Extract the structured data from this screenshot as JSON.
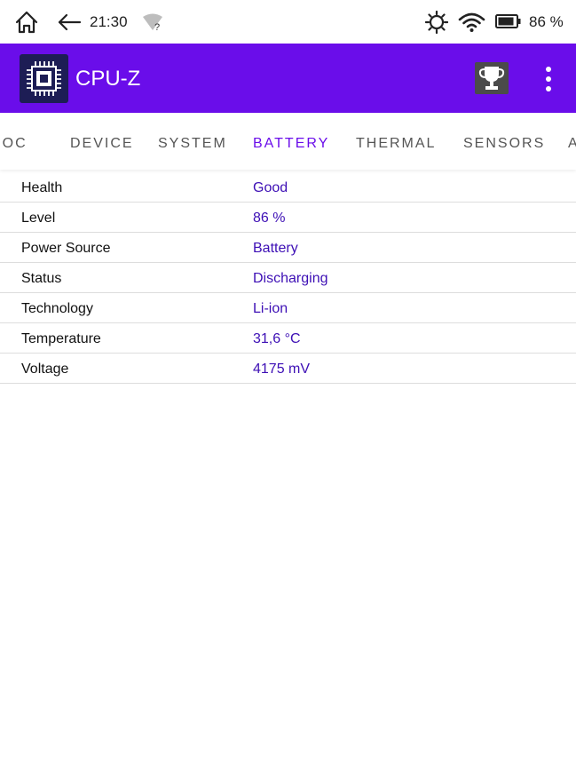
{
  "status_bar": {
    "time": "21:30",
    "battery_percent": "86 %",
    "icons": [
      "home-icon",
      "back-arrow-icon",
      "wifi-unknown-icon",
      "brightness-icon",
      "wifi-icon",
      "battery-icon"
    ]
  },
  "app_bar": {
    "title": "CPU-Z",
    "icons": [
      "cpu-chip-icon",
      "trophy-icon",
      "more-vert-icon"
    ],
    "colors": {
      "primary": "#6a0dea",
      "logo_bg": "#1d1d55"
    }
  },
  "tabs": [
    {
      "label": "SOC"
    },
    {
      "label": "DEVICE"
    },
    {
      "label": "SYSTEM"
    },
    {
      "label": "BATTERY",
      "active": true
    },
    {
      "label": "THERMAL"
    },
    {
      "label": "SENSORS"
    },
    {
      "label": "A"
    }
  ],
  "battery": {
    "rows": [
      {
        "label": "Health",
        "value": "Good"
      },
      {
        "label": "Level",
        "value": "86 %"
      },
      {
        "label": "Power Source",
        "value": "Battery"
      },
      {
        "label": "Status",
        "value": "Discharging"
      },
      {
        "label": "Technology",
        "value": "Li-ion"
      },
      {
        "label": "Temperature",
        "value": "31,6 °C"
      },
      {
        "label": "Voltage",
        "value": "4175 mV"
      }
    ],
    "colors": {
      "value_text": "#3d0fb5",
      "active_tab": "#6a0dea"
    }
  }
}
